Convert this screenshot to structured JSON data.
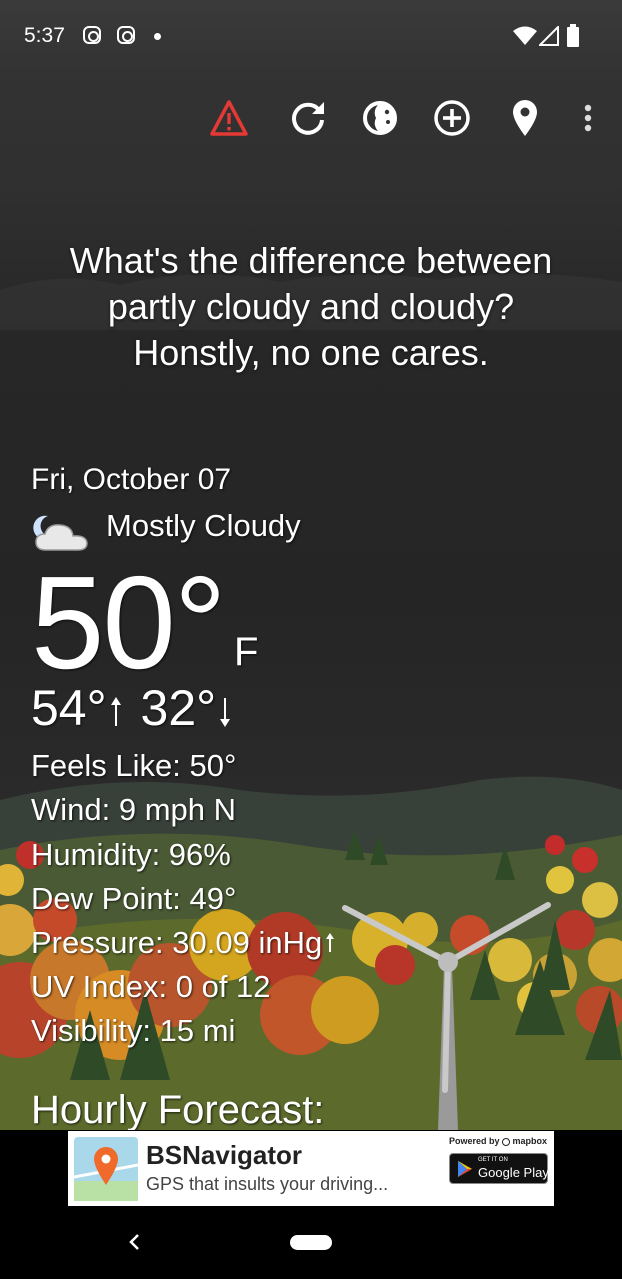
{
  "status_bar": {
    "time": "5:37",
    "icons": [
      "instagram-icon",
      "instagram-icon",
      "dot-icon",
      "wifi-icon",
      "signal-icon",
      "battery-icon"
    ]
  },
  "toolbar": {
    "icons": [
      "alert-triangle-icon",
      "refresh-icon",
      "theme-icon",
      "add-location-icon",
      "location-pin-icon",
      "overflow-menu-icon"
    ],
    "alert_color": "#e53935"
  },
  "quote": {
    "line1": "What's the difference between",
    "line2": "partly cloudy and cloudy?",
    "line3": "Honstly, no one cares."
  },
  "weather": {
    "date": "Fri, October 07",
    "condition": "Mostly Cloudy",
    "condition_icon": "moon-cloud-icon",
    "temperature": "50°",
    "unit": "F",
    "high": "54°",
    "low": "32°",
    "details": {
      "feels_like": "Feels Like:  50°",
      "wind": "Wind:  9 mph N",
      "humidity": "Humidity:  96%",
      "dew_point": "Dew Point:  49°",
      "pressure": "Pressure:  30.09 inHg",
      "uv_index": "UV Index:  0 of 12",
      "visibility": "Visibility:  15 mi"
    }
  },
  "hourly_heading": "Hourly Forecast:",
  "ad": {
    "title": "BSNavigator",
    "subtitle": "GPS that insults your driving...",
    "powered_by": "Powered by",
    "brand": "mapbox",
    "store_top": "GET IT ON",
    "store": "Google Play"
  },
  "nav_bar": {
    "icons": [
      "back-icon",
      "home-pill-icon"
    ]
  }
}
